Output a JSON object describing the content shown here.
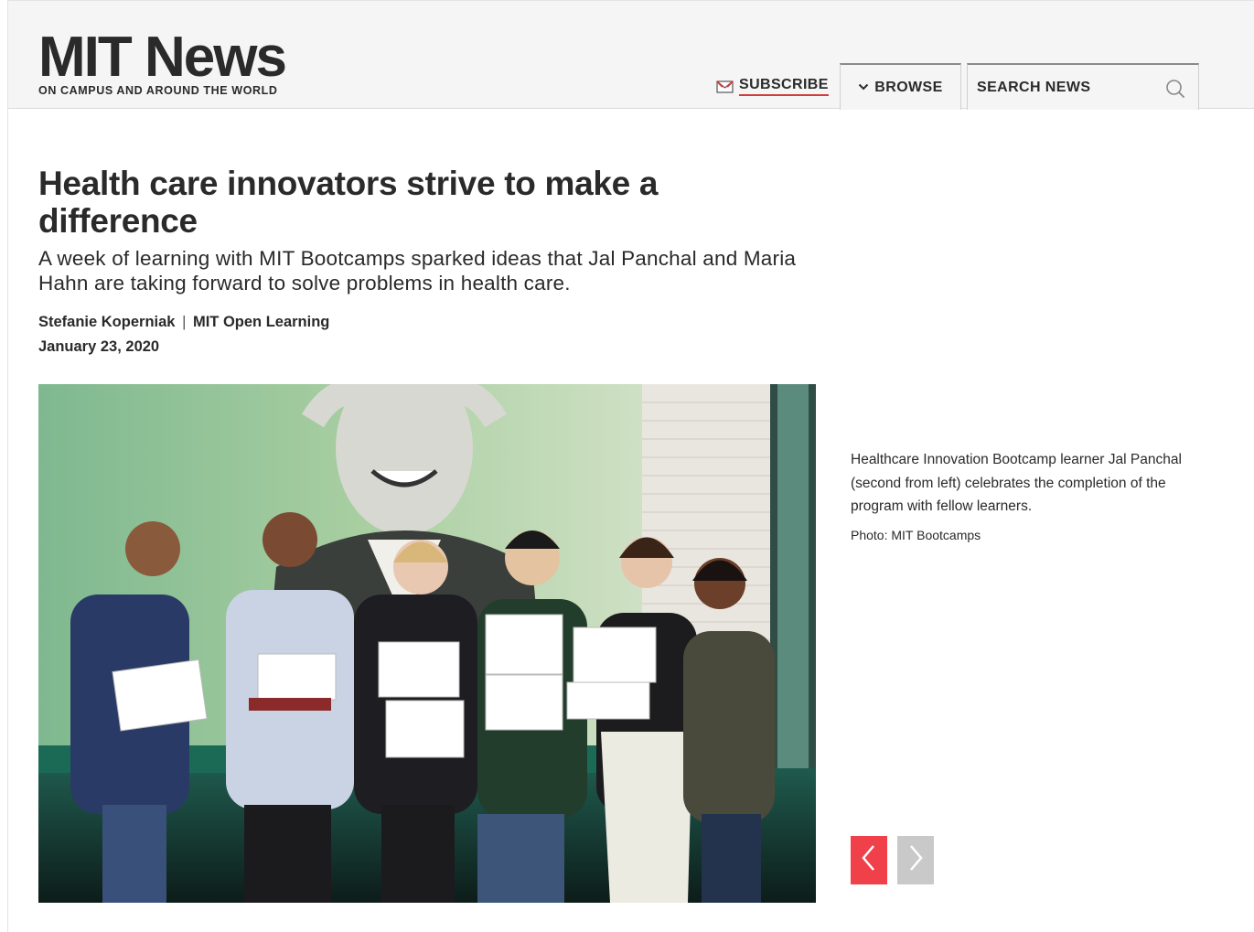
{
  "header": {
    "brand_title": "MIT News",
    "brand_tagline": "ON CAMPUS AND AROUND THE WORLD",
    "subscribe_label": "SUBSCRIBE",
    "browse_label": "BROWSE",
    "search_placeholder": "SEARCH NEWS"
  },
  "article": {
    "headline": "Health care innovators strive to make a difference",
    "dek": "A week of learning with MIT Bootcamps sparked ideas that Jal Panchal and Maria Hahn are taking forward to solve problems in health care.",
    "author": "Stefanie Koperniak",
    "separator": "|",
    "department": "MIT Open Learning",
    "date": "January 23, 2020"
  },
  "media": {
    "caption": "Healthcare Innovation Bootcamp learner Jal Panchal (second from left) celebrates the completion of the program with fellow learners.",
    "credit": "Photo: MIT Bootcamps"
  },
  "icons": {
    "subscribe": "envelope-icon",
    "browse": "chevron-down-icon",
    "search": "search-icon",
    "prev": "chevron-left-icon",
    "next": "chevron-right-icon"
  },
  "colors": {
    "accent_red": "#f0404a",
    "underline_red": "#d43c3c",
    "header_bg": "#f5f5f5",
    "text": "#2a2a2a"
  }
}
